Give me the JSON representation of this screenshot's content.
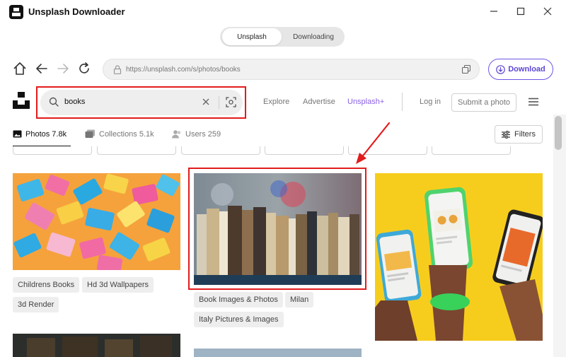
{
  "app": {
    "title": "Unsplash Downloader",
    "icons": [
      "app-logo",
      "minimize-icon",
      "maximize-icon",
      "close-icon"
    ]
  },
  "tabs": {
    "unsplash": "Unsplash",
    "downloading": "Downloading",
    "active": "Unsplash"
  },
  "nav": {
    "url": "https://unsplash.com/s/photos/books",
    "download_label": "Download",
    "icons": [
      "home-icon",
      "back-icon",
      "forward-icon",
      "reload-icon",
      "lock-icon",
      "copy-icon",
      "download-icon"
    ]
  },
  "site": {
    "search_value": "books",
    "links": {
      "explore": "Explore",
      "advertise": "Advertise",
      "unsplash_plus": "Unsplash+",
      "login": "Log in",
      "submit": "Submit a photo"
    }
  },
  "filter_tabs": {
    "photos": "Photos 7.8k",
    "collections": "Collections 5.1k",
    "users": "Users 259",
    "filters": "Filters"
  },
  "results": {
    "col1_tags": [
      "Childrens Books",
      "Hd 3d Wallpapers",
      "3d Render"
    ],
    "col2_tags": [
      "Book Images & Photos",
      "Milan",
      "Italy Pictures & Images"
    ]
  },
  "colors": {
    "accent": "#6b57e6",
    "highlight": "#e21b1b",
    "unsplash_plus": "#8a61e4"
  }
}
